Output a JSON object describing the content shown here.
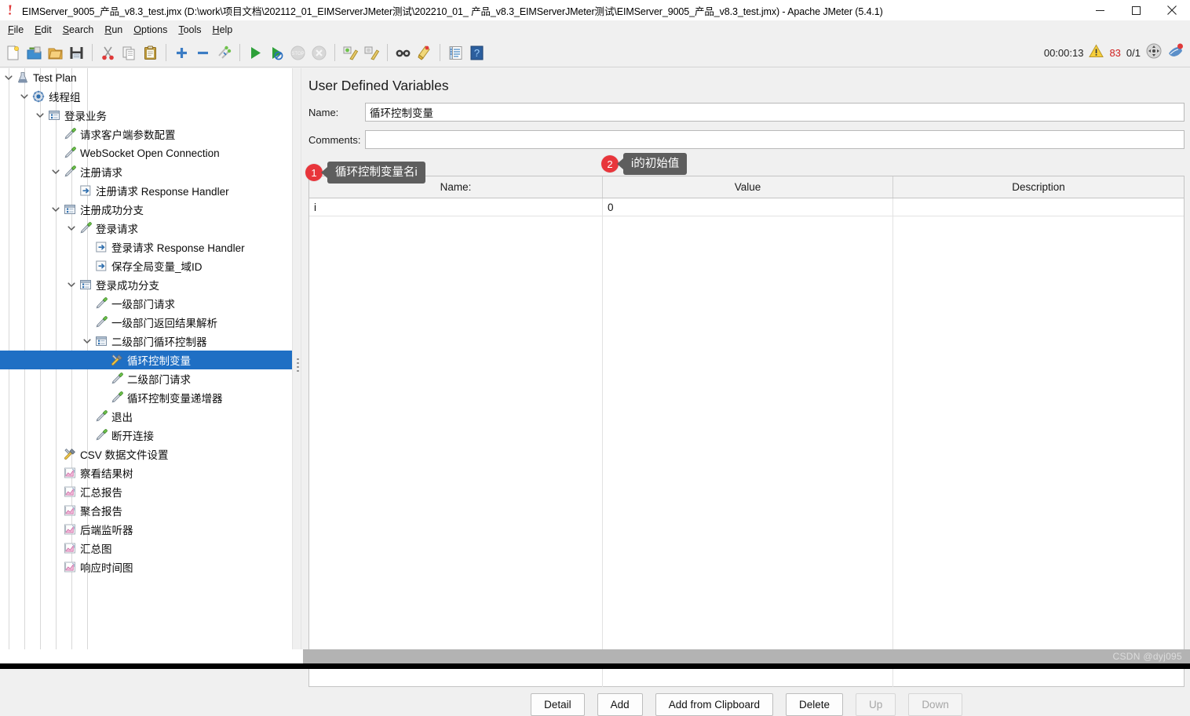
{
  "window": {
    "title": "EIMServer_9005_产品_v8.3_test.jmx (D:\\work\\项目文档\\202112_01_EIMServerJMeter测试\\202210_01_ 产品_v8.3_EIMServerJMeter测试\\EIMServer_9005_产品_v8.3_test.jmx) - Apache JMeter (5.4.1)",
    "minimize_label": "Minimize",
    "maximize_label": "Maximize",
    "close_label": "Close"
  },
  "menubar": {
    "items": [
      {
        "label": "File",
        "mnemonic": "F"
      },
      {
        "label": "Edit",
        "mnemonic": "E"
      },
      {
        "label": "Search",
        "mnemonic": "S"
      },
      {
        "label": "Run",
        "mnemonic": "R"
      },
      {
        "label": "Options",
        "mnemonic": "O"
      },
      {
        "label": "Tools",
        "mnemonic": "T"
      },
      {
        "label": "Help",
        "mnemonic": "H"
      }
    ]
  },
  "toolbar": {
    "buttons": [
      {
        "name": "new-icon",
        "tip": "New",
        "enabled": true
      },
      {
        "name": "templates-icon",
        "tip": "Templates",
        "enabled": true
      },
      {
        "name": "open-icon",
        "tip": "Open",
        "enabled": true
      },
      {
        "name": "save-icon",
        "tip": "Save Test Plan",
        "enabled": true
      },
      {
        "name": "cut-icon",
        "tip": "Cut",
        "enabled": true
      },
      {
        "name": "copy-icon",
        "tip": "Copy",
        "enabled": true
      },
      {
        "name": "paste-icon",
        "tip": "Paste",
        "enabled": true
      },
      {
        "name": "expand-all-icon",
        "tip": "Expand All",
        "enabled": true
      },
      {
        "name": "collapse-all-icon",
        "tip": "Collapse All",
        "enabled": true
      },
      {
        "name": "toggle-icon",
        "tip": "Toggle",
        "enabled": true
      },
      {
        "name": "start-icon",
        "tip": "Start",
        "enabled": true
      },
      {
        "name": "start-no-pauses-icon",
        "tip": "Start no pauses",
        "enabled": true
      },
      {
        "name": "stop-icon",
        "tip": "Stop",
        "enabled": false
      },
      {
        "name": "shutdown-icon",
        "tip": "Shutdown",
        "enabled": false
      },
      {
        "name": "clear-icon",
        "tip": "Clear",
        "enabled": true
      },
      {
        "name": "clear-all-icon",
        "tip": "Clear All",
        "enabled": true
      },
      {
        "name": "search-icon",
        "tip": "Search",
        "enabled": true
      },
      {
        "name": "reset-search-icon",
        "tip": "Reset Search",
        "enabled": true
      },
      {
        "name": "function-helper-icon",
        "tip": "Function Helper Dialog",
        "enabled": true
      },
      {
        "name": "help-icon",
        "tip": "Help",
        "enabled": true
      }
    ],
    "elapsed_time": "00:00:13",
    "warning_count": "83",
    "thread_counts": "0/1",
    "error_color": "#d02020"
  },
  "tree": {
    "selected_color": "#1f6fc4",
    "nodes": [
      {
        "label": "Test Plan",
        "depth": 0,
        "icon": "test-plan-icon",
        "twist": "down",
        "selected": false
      },
      {
        "label": "线程组",
        "depth": 1,
        "icon": "thread-group-icon",
        "twist": "down",
        "selected": false
      },
      {
        "label": "登录业务",
        "depth": 2,
        "icon": "controller-icon",
        "twist": "down",
        "selected": false
      },
      {
        "label": "请求客户端参数配置",
        "depth": 3,
        "icon": "sampler-icon",
        "twist": "none",
        "selected": false
      },
      {
        "label": "WebSocket Open Connection",
        "depth": 3,
        "icon": "sampler-icon",
        "twist": "none",
        "selected": false
      },
      {
        "label": "注册请求",
        "depth": 3,
        "icon": "sampler-icon",
        "twist": "down",
        "selected": false
      },
      {
        "label": "注册请求 Response Handler",
        "depth": 4,
        "icon": "postprocessor-icon",
        "twist": "none",
        "selected": false
      },
      {
        "label": "注册成功分支",
        "depth": 3,
        "icon": "controller-icon",
        "twist": "down",
        "selected": false
      },
      {
        "label": "登录请求",
        "depth": 4,
        "icon": "sampler-icon",
        "twist": "down",
        "selected": false
      },
      {
        "label": "登录请求 Response Handler",
        "depth": 5,
        "icon": "postprocessor-icon",
        "twist": "none",
        "selected": false
      },
      {
        "label": "保存全局变量_域ID",
        "depth": 5,
        "icon": "postprocessor-icon",
        "twist": "none",
        "selected": false
      },
      {
        "label": "登录成功分支",
        "depth": 4,
        "icon": "controller-icon",
        "twist": "down",
        "selected": false
      },
      {
        "label": "一级部门请求",
        "depth": 5,
        "icon": "sampler-icon",
        "twist": "none",
        "selected": false
      },
      {
        "label": "一级部门返回结果解析",
        "depth": 5,
        "icon": "sampler-icon",
        "twist": "none",
        "selected": false
      },
      {
        "label": "二级部门循环控制器",
        "depth": 5,
        "icon": "controller-icon",
        "twist": "down",
        "selected": false
      },
      {
        "label": "循环控制变量",
        "depth": 6,
        "icon": "config-element-icon",
        "twist": "none",
        "selected": true
      },
      {
        "label": "二级部门请求",
        "depth": 6,
        "icon": "sampler-icon",
        "twist": "none",
        "selected": false
      },
      {
        "label": "循环控制变量递增器",
        "depth": 6,
        "icon": "sampler-icon",
        "twist": "none",
        "selected": false
      },
      {
        "label": "退出",
        "depth": 5,
        "icon": "sampler-icon",
        "twist": "none",
        "selected": false
      },
      {
        "label": "断开连接",
        "depth": 5,
        "icon": "sampler-icon",
        "twist": "none",
        "selected": false
      },
      {
        "label": "CSV 数据文件设置",
        "depth": 3,
        "icon": "config-element-icon",
        "twist": "none",
        "selected": false
      },
      {
        "label": "察看结果树",
        "depth": 3,
        "icon": "listener-icon",
        "twist": "none",
        "selected": false
      },
      {
        "label": "汇总报告",
        "depth": 3,
        "icon": "listener-icon",
        "twist": "none",
        "selected": false
      },
      {
        "label": "聚合报告",
        "depth": 3,
        "icon": "listener-icon",
        "twist": "none",
        "selected": false
      },
      {
        "label": "后端监听器",
        "depth": 3,
        "icon": "listener-icon",
        "twist": "none",
        "selected": false
      },
      {
        "label": "汇总图",
        "depth": 3,
        "icon": "listener-icon",
        "twist": "none",
        "selected": false
      },
      {
        "label": "响应时间图",
        "depth": 3,
        "icon": "listener-icon",
        "twist": "none",
        "selected": false
      }
    ]
  },
  "panel": {
    "title": "User Defined Variables",
    "name_label": "Name:",
    "name_value": "循环控制变量",
    "name_placeholder": "",
    "comments_label": "Comments:",
    "comments_value": "",
    "comments_placeholder": "",
    "table_caption": "User Defined Variables",
    "table": {
      "columns": [
        "Name:",
        "Value",
        "Description"
      ],
      "rows": [
        {
          "name": "i",
          "value": "0",
          "description": ""
        }
      ]
    },
    "buttons": [
      {
        "label": "Detail",
        "enabled": true
      },
      {
        "label": "Add",
        "enabled": true
      },
      {
        "label": "Add from Clipboard",
        "enabled": true
      },
      {
        "label": "Delete",
        "enabled": true
      },
      {
        "label": "Up",
        "enabled": false
      },
      {
        "label": "Down",
        "enabled": false
      }
    ]
  },
  "callouts": [
    {
      "number": "1",
      "text": "循环控制变量名i",
      "color": "#e8353b",
      "bg": "#5e5e5e"
    },
    {
      "number": "2",
      "text": "i的初始值",
      "color": "#e8353b",
      "bg": "#5e5e5e"
    }
  ],
  "watermark": {
    "text": "CSDN @dyj095"
  }
}
